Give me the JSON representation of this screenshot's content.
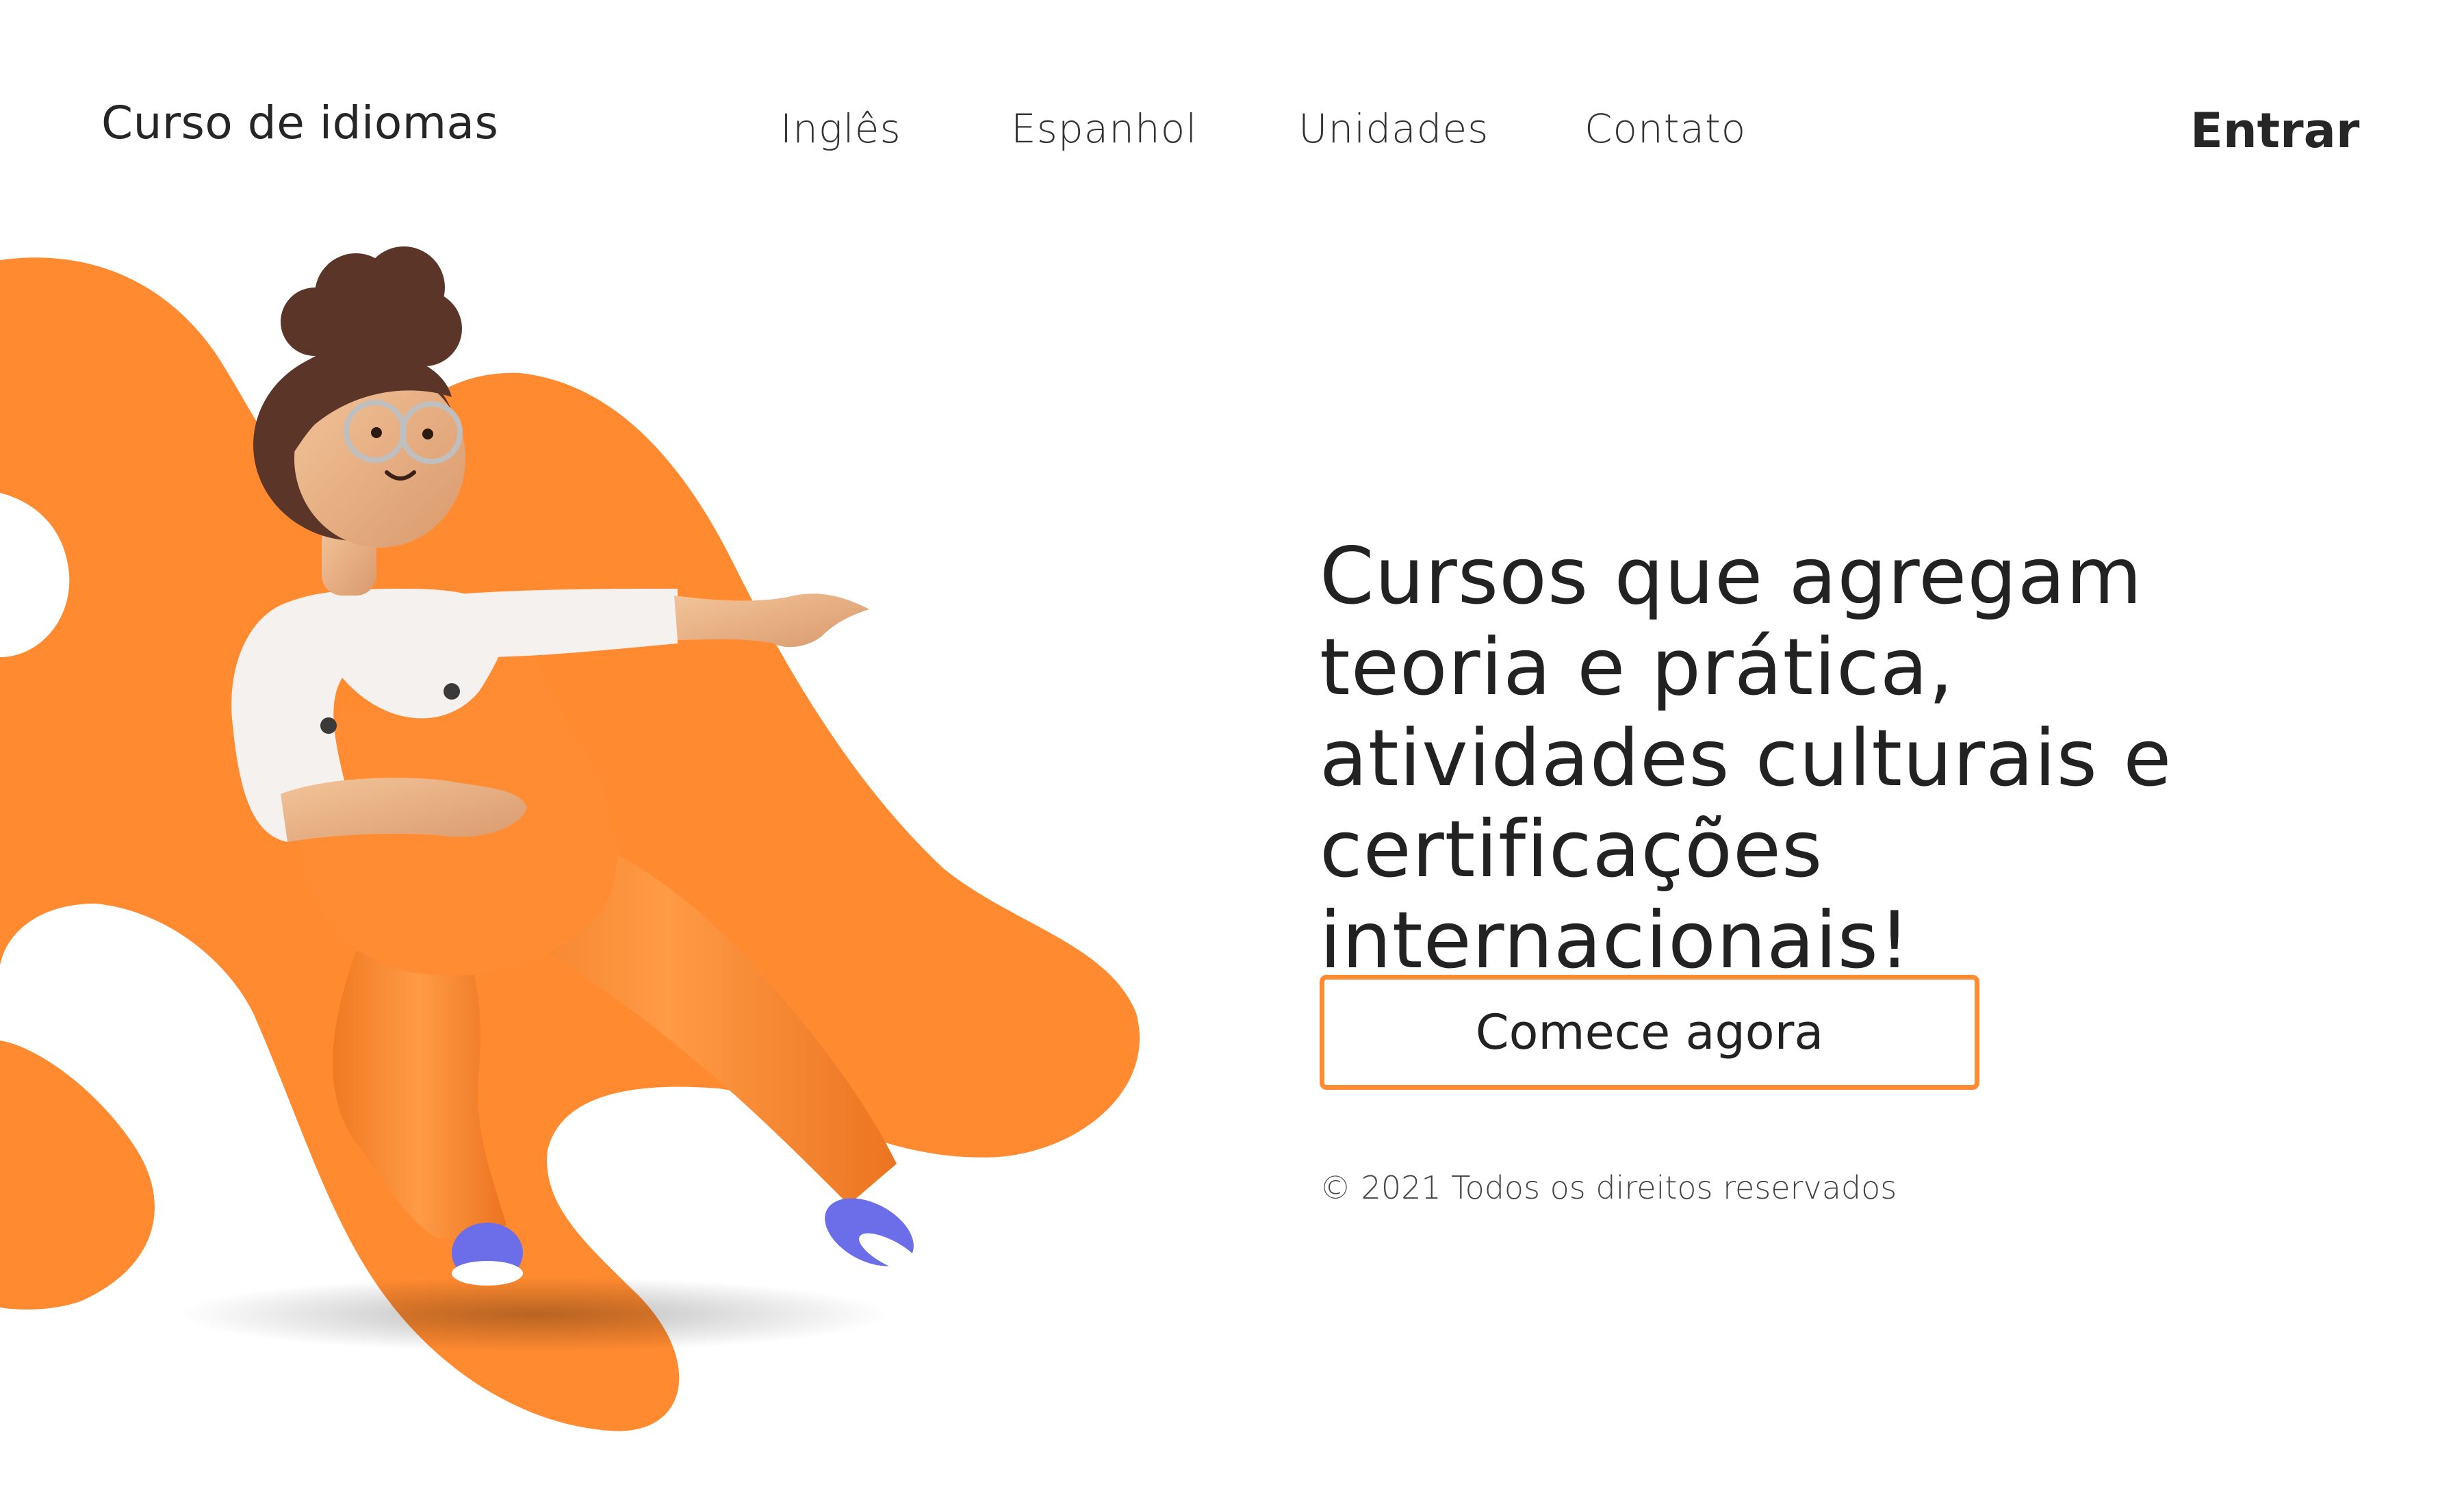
{
  "header": {
    "brand": "Curso de idiomas",
    "nav": [
      {
        "label": "Inglês"
      },
      {
        "label": "Espanhol"
      },
      {
        "label": "Unidades"
      },
      {
        "label": "Contato"
      }
    ],
    "login_label": "Entrar"
  },
  "hero": {
    "headline": "Cursos que agregam teoria e prática, atividades culturais e certificações internacionais!",
    "cta_label": "Comece agora",
    "copyright": "© 2021 Todos os direitos reservados"
  },
  "colors": {
    "accent": "#ff8c33",
    "text": "#222222",
    "background": "#ffffff"
  }
}
